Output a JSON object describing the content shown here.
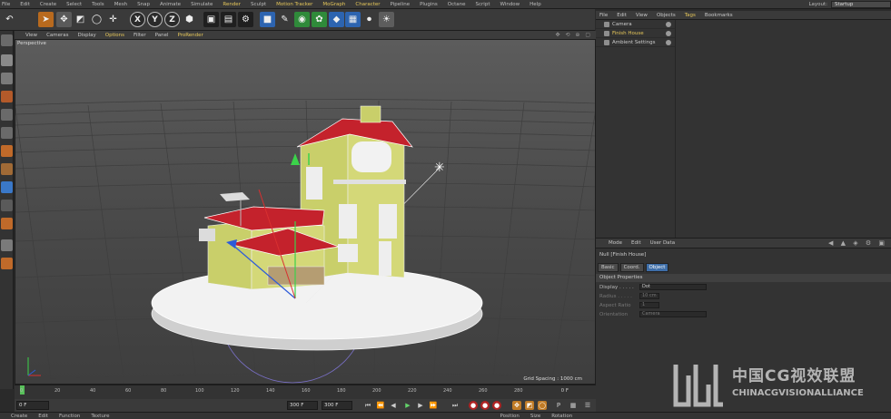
{
  "menubar": {
    "items": [
      "File",
      "Edit",
      "Create",
      "Select",
      "Tools",
      "Mesh",
      "Snap",
      "Animate",
      "Simulate",
      "Render",
      "Sculpt",
      "Motion Tracker",
      "MoGraph",
      "Character",
      "Pipeline",
      "Plugins",
      "Octane",
      "Script",
      "Window",
      "Help"
    ],
    "layout_label": "Layout:",
    "layout_value": "Startup"
  },
  "toolbar": {
    "icons": [
      "undo-icon",
      "live-select-icon",
      "move-icon",
      "scale-icon",
      "rotate-icon",
      "recent-tool-icon",
      "x-axis-icon",
      "y-axis-icon",
      "z-axis-icon",
      "world-coordinates-icon",
      "render-view-icon",
      "render-picture-viewer-icon",
      "edit-render-settings-icon",
      "cube-icon",
      "pen-icon",
      "subdivision-icon",
      "cloner-icon",
      "deformer-icon",
      "floor-icon",
      "camera-icon",
      "light-icon"
    ],
    "axis_labels": [
      "X",
      "Y",
      "Z"
    ]
  },
  "viewport": {
    "menu": [
      "View",
      "Cameras",
      "Display",
      "Options",
      "Filter",
      "Panel",
      "ProRender"
    ],
    "label": "Perspective",
    "grid_spacing": "Grid Spacing : 1000 cm"
  },
  "timeline": {
    "ticks": [
      "0",
      "20",
      "40",
      "60",
      "80",
      "100",
      "120",
      "140",
      "160",
      "180",
      "200",
      "220",
      "240",
      "260",
      "280"
    ],
    "end_frame": "0 F",
    "current_frame": "0 F",
    "start_field": "0 F",
    "end_field": "300 F",
    "end_field2": "300 F"
  },
  "object_manager": {
    "menu": [
      "File",
      "Edit",
      "View",
      "Objects",
      "Tags",
      "Bookmarks"
    ],
    "objects": [
      {
        "name": "Camera",
        "icon": "camera-icon"
      },
      {
        "name": "Finish House",
        "icon": "null-object-icon"
      },
      {
        "name": "Ambient Settings",
        "icon": "null-object-icon"
      }
    ]
  },
  "attribute_manager": {
    "menu": [
      "Mode",
      "Edit",
      "User Data"
    ],
    "title": "Null [Finish House]",
    "tabs": [
      "Basic",
      "Coord.",
      "Object"
    ],
    "active_tab": "Object",
    "section": "Object Properties",
    "properties": [
      {
        "label": "Display . . . . .",
        "value": "Dot"
      },
      {
        "label": "Radius . . . . .",
        "value": "10 cm"
      },
      {
        "label": "Aspect Ratio",
        "value": "1"
      },
      {
        "label": "Orientation",
        "value": "Camera"
      }
    ]
  },
  "bottombar": {
    "items": [
      "Create",
      "Edit",
      "Function",
      "Texture",
      "Position",
      "Size",
      "Rotation"
    ]
  },
  "watermark": {
    "cn": "中国CG视效联盟",
    "en": "CHINACGVISIONALLIANCE"
  },
  "colors": {
    "accent": "#e6c75a",
    "roof_red": "#c4222c",
    "wall_yellow": "#c9cf6a",
    "selected_tab": "#3e6ea8"
  }
}
